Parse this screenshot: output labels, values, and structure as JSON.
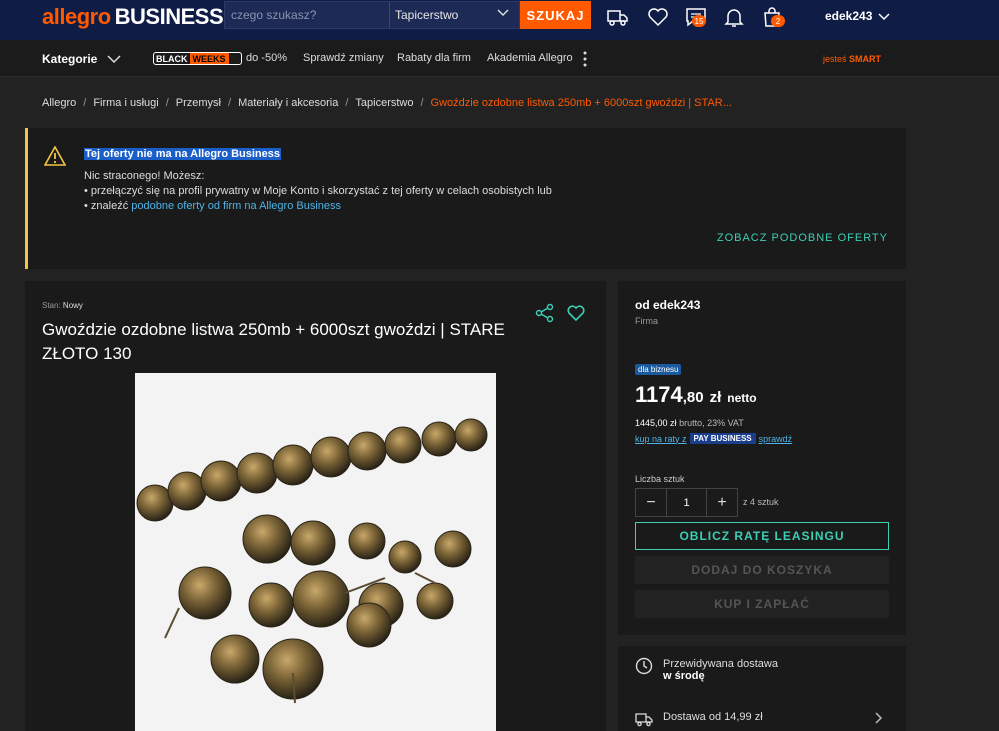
{
  "header": {
    "logo_main": "allegro",
    "logo_sub": "BUSINESS",
    "search_placeholder": "czego szukasz?",
    "category_select": "Tapicerstwo",
    "search_button": "SZUKAJ",
    "messages_count": "15",
    "cart_count": "2",
    "username": "edek243"
  },
  "nav": {
    "categories": "Kategorie",
    "black_weeks_1": "BLACK",
    "black_weeks_2": "WEEKS",
    "promo": "do -50%",
    "links": [
      "Sprawdź zmiany",
      "Rabaty dla firm",
      "Akademia Allegro"
    ],
    "smart_prefix": "jesteś",
    "smart": "SMART"
  },
  "breadcrumb": [
    "Allegro",
    "Firma i usługi",
    "Przemysł",
    "Materiały i akcesoria",
    "Tapicerstwo",
    "Gwoździe ozdobne listwa 250mb + 6000szt gwoździ | STAR..."
  ],
  "notice": {
    "title": "Tej oferty nie ma na Allegro Business",
    "line1": "Nic straconego! Możesz:",
    "line2": "• przełączyć się na profil prywatny w Moje Konto i skorzystać z tej oferty w celach osobistych lub",
    "line3_prefix": "• znaleźć ",
    "line3_link": "podobne oferty od firm na Allegro Business",
    "action": "ZOBACZ PODOBNE OFERTY"
  },
  "product": {
    "condition_label": "Stan:",
    "condition_value": "Nowy",
    "title": "Gwoździe ozdobne listwa 250mb + 6000szt gwoździ | STARE ZŁOTO 130"
  },
  "buy": {
    "seller": "od edek243",
    "seller_type": "Firma",
    "biz_badge": "dla biznesu",
    "price_int": "1174",
    "price_dec": ",80",
    "currency": "zł",
    "netto": "netto",
    "brutto_value": "1445,00 zł",
    "brutto_text": "brutto, 23% VAT",
    "raty_prefix": "kup na raty z",
    "paybiz": "PAY BUSINESS",
    "raty_check": "sprawdź",
    "qty_label": "Liczba sztuk",
    "qty_value": "1",
    "qty_of": "z 4 sztuk",
    "lease_button": "OBLICZ RATĘ LEASINGU",
    "cart_button": "DODAJ DO KOSZYKA",
    "pay_button": "KUP I ZAPŁAĆ"
  },
  "delivery": {
    "expected_label": "Przewidywana dostawa",
    "expected_value": "w środę",
    "cost": "Dostawa od 14,99 zł"
  }
}
